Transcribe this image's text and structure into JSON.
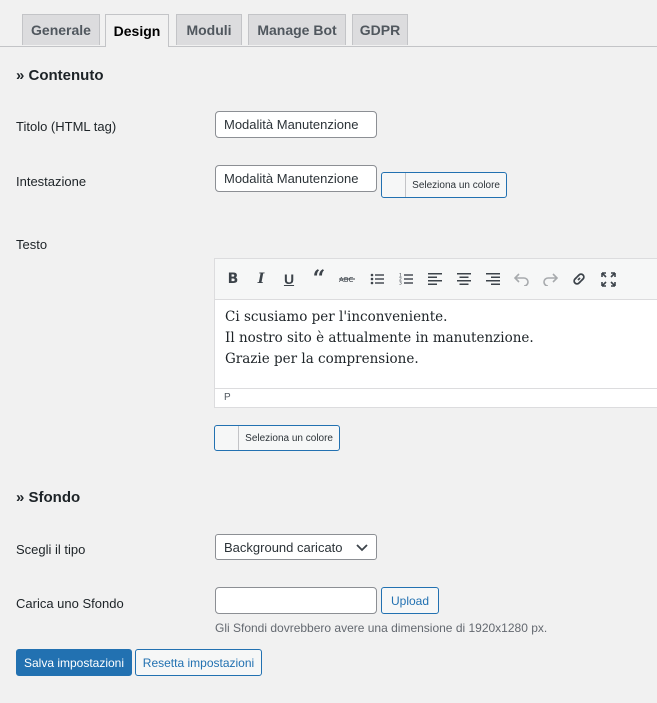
{
  "tabs": [
    {
      "label": "Generale",
      "active": false
    },
    {
      "label": "Design",
      "active": true
    },
    {
      "label": "Moduli",
      "active": false
    },
    {
      "label": "Manage Bot",
      "active": false
    },
    {
      "label": "GDPR",
      "active": false
    }
  ],
  "content_section": {
    "title": "» Contenuto",
    "title_field": {
      "label": "Titolo (HTML tag)",
      "value": "Modalità Manutenzione"
    },
    "heading_field": {
      "label": "Intestazione",
      "value": "Modalità Manutenzione",
      "color_button": "Seleziona un colore"
    },
    "text_field": {
      "label": "Testo",
      "toolbar": [
        "bold-icon",
        "italic-icon",
        "underline-icon",
        "blockquote-icon",
        "strikethrough-icon",
        "bullet-list-icon",
        "numbered-list-icon",
        "align-left-icon",
        "align-center-icon",
        "align-right-icon",
        "undo-icon",
        "redo-icon",
        "link-icon",
        "fullscreen-icon"
      ],
      "lines": [
        "Ci scusiamo per l'inconveniente.",
        "Il nostro sito è attualmente in manutenzione.",
        "Grazie per la comprensione."
      ],
      "status_path": "P",
      "color_button": "Seleziona un colore"
    }
  },
  "background_section": {
    "title": "» Sfondo",
    "type_field": {
      "label": "Scegli il tipo",
      "selected": "Background caricato"
    },
    "upload_field": {
      "label": "Carica uno Sfondo",
      "value": "",
      "button": "Upload",
      "hint": "Gli Sfondi dovrebbero avere una dimensione di 1920x1280 px."
    }
  },
  "actions": {
    "save": "Salva impostazioni",
    "reset": "Resetta impostazioni"
  },
  "colors": {
    "accent": "#2271b1",
    "background": "#f1f1f1"
  }
}
